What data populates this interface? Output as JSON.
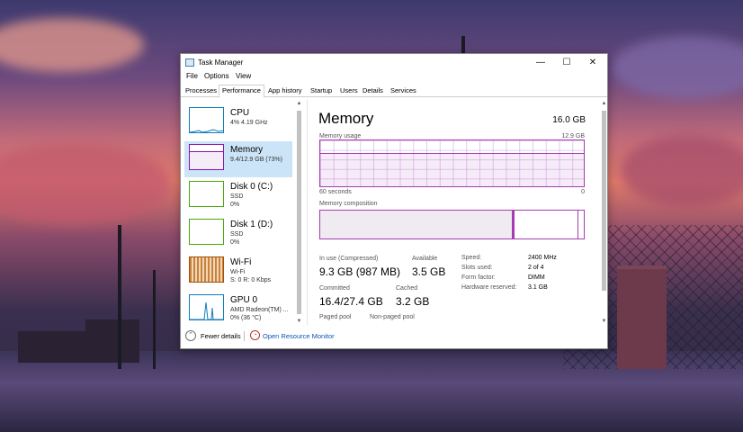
{
  "window": {
    "title": "Task Manager",
    "buttons": {
      "minimize": "—",
      "maximize": "☐",
      "close": "✕"
    }
  },
  "menu": [
    "File",
    "Options",
    "View"
  ],
  "tabs": [
    {
      "label": "Processes",
      "active": false
    },
    {
      "label": "Performance",
      "active": true
    },
    {
      "label": "App history",
      "active": false
    },
    {
      "label": "Startup",
      "active": false
    },
    {
      "label": "Users",
      "active": false
    },
    {
      "label": "Details",
      "active": false
    },
    {
      "label": "Services",
      "active": false
    }
  ],
  "sidebar": {
    "items": [
      {
        "name": "CPU",
        "line1": "4% 4.19 GHz",
        "line2": "",
        "color": "#117dbb",
        "selected": false
      },
      {
        "name": "Memory",
        "line1": "9.4/12.9 GB (73%)",
        "line2": "",
        "color": "#8b12ae",
        "selected": true
      },
      {
        "name": "Disk 0 (C:)",
        "line1": "SSD",
        "line2": "0%",
        "color": "#4da60c",
        "selected": false
      },
      {
        "name": "Disk 1 (D:)",
        "line1": "SSD",
        "line2": "0%",
        "color": "#4da60c",
        "selected": false
      },
      {
        "name": "Wi-Fi",
        "line1": "Wi-Fi",
        "line2": "S: 0 R: 0 Kbps",
        "color": "#a74f01",
        "selected": false
      },
      {
        "name": "GPU 0",
        "line1": "AMD Radeon(TM) ...",
        "line2": "0% (36 °C)",
        "color": "#117dbb",
        "selected": false
      }
    ]
  },
  "detail": {
    "title": "Memory",
    "total": "16.0 GB",
    "usage_label": "Memory usage",
    "usage_max": "12.9 GB",
    "time_left": "60 seconds",
    "time_right": "0",
    "composition_label": "Memory composition",
    "usage_fraction": 0.73,
    "stats": {
      "in_use_label": "In use (Compressed)",
      "in_use_value": "9.3 GB (987 MB)",
      "available_label": "Available",
      "available_value": "3.5 GB",
      "committed_label": "Committed",
      "committed_value": "16.4/27.4 GB",
      "cached_label": "Cached",
      "cached_value": "3.2 GB",
      "paged_label": "Paged pool",
      "nonpaged_label": "Non-paged pool"
    },
    "specs": [
      {
        "label": "Speed:",
        "value": "2400 MHz"
      },
      {
        "label": "Slots used:",
        "value": "2 of 4"
      },
      {
        "label": "Form factor:",
        "value": "DIMM"
      },
      {
        "label": "Hardware reserved:",
        "value": "3.1 GB"
      }
    ]
  },
  "footer": {
    "fewer_details": "Fewer details",
    "open_resource_monitor": "Open Resource Monitor"
  }
}
